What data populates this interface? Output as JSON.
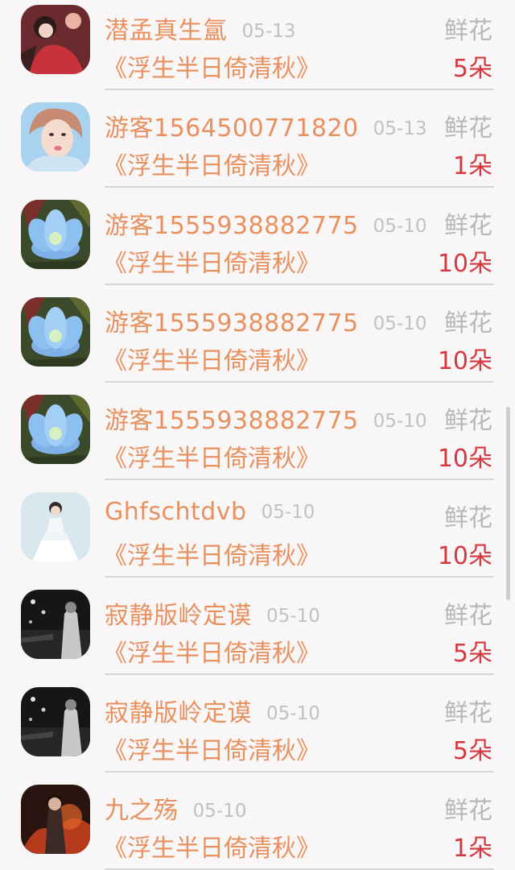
{
  "rows": [
    {
      "name": "潜孟真生氲",
      "date": "05-13",
      "gift": "鲜花",
      "title": "《浮生半日倚清秋》",
      "count": "5朵",
      "avatar": "girl-red-avatar"
    },
    {
      "name": "游客1564500771820",
      "date": "05-13",
      "gift": "鲜花",
      "title": "《浮生半日倚清秋》",
      "count": "1朵",
      "avatar": "woman-portrait-avatar"
    },
    {
      "name": "游客1555938882775",
      "date": "05-10",
      "gift": "鲜花",
      "title": "《浮生半日倚清秋》",
      "count": "10朵",
      "avatar": "blue-flower-avatar"
    },
    {
      "name": "游客1555938882775",
      "date": "05-10",
      "gift": "鲜花",
      "title": "《浮生半日倚清秋》",
      "count": "10朵",
      "avatar": "blue-flower-avatar"
    },
    {
      "name": "游客1555938882775",
      "date": "05-10",
      "gift": "鲜花",
      "title": "《浮生半日倚清秋》",
      "count": "10朵",
      "avatar": "blue-flower-avatar"
    },
    {
      "name": "Ghfschtdvb",
      "date": "05-10",
      "gift": "鲜花",
      "title": "《浮生半日倚清秋》",
      "count": "10朵",
      "avatar": "girl-white-dress-avatar"
    },
    {
      "name": "寂静版岭定谟",
      "date": "05-10",
      "gift": "鲜花",
      "title": "《浮生半日倚清秋》",
      "count": "5朵",
      "avatar": "night-street-avatar"
    },
    {
      "name": "寂静版岭定谟",
      "date": "05-10",
      "gift": "鲜花",
      "title": "《浮生半日倚清秋》",
      "count": "5朵",
      "avatar": "night-street-avatar"
    },
    {
      "name": "九之殇",
      "date": "05-10",
      "gift": "鲜花",
      "title": "《浮生半日倚清秋》",
      "count": "1朵",
      "avatar": "warrior-fire-avatar"
    }
  ],
  "colors": {
    "name": "#e8915f",
    "date": "#c3c0c1",
    "gift": "#b9b6b7",
    "count": "#d5393f",
    "background": "#f8f6f7"
  }
}
